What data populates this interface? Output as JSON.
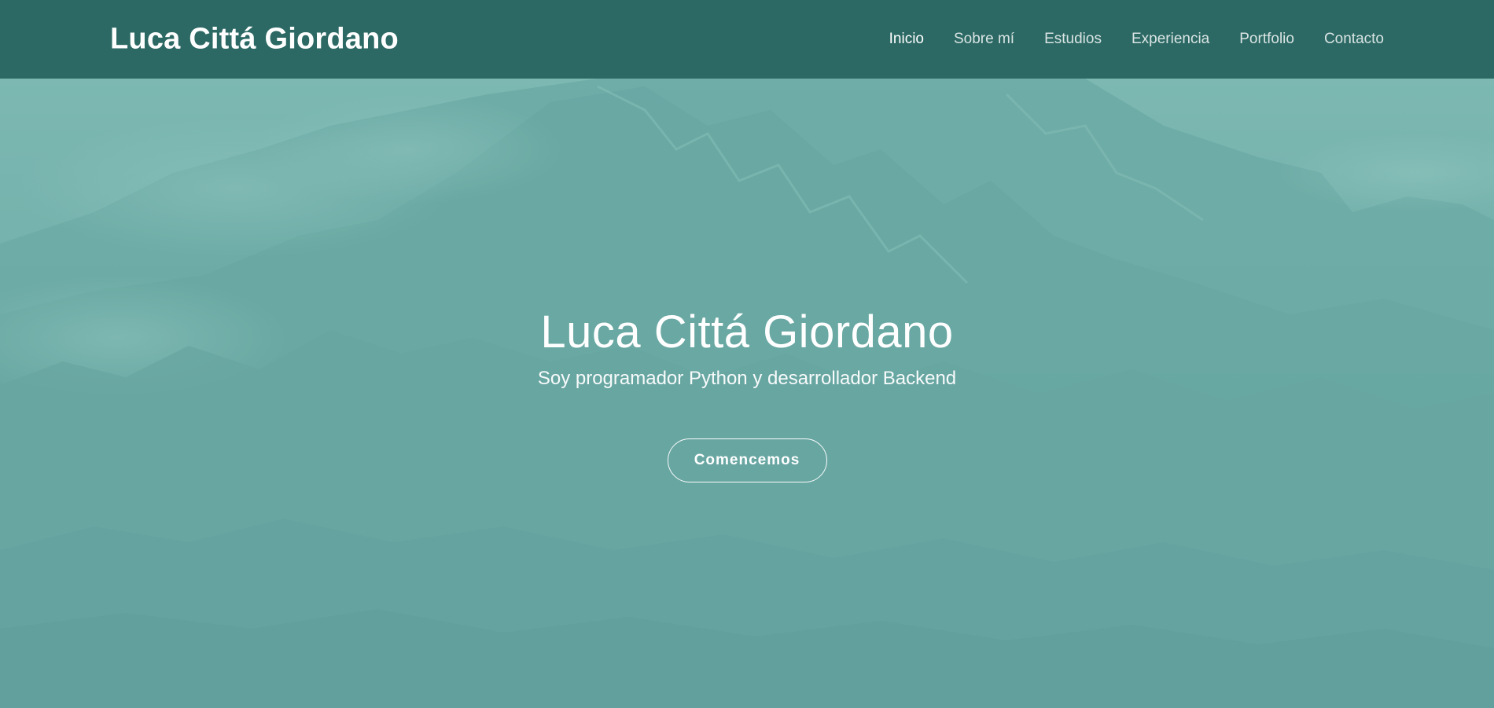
{
  "navbar": {
    "brand": "Luca Cittá Giordano",
    "links": [
      {
        "label": "Inicio",
        "active": true
      },
      {
        "label": "Sobre mí",
        "active": false
      },
      {
        "label": "Estudios",
        "active": false
      },
      {
        "label": "Experiencia",
        "active": false
      },
      {
        "label": "Portfolio",
        "active": false
      },
      {
        "label": "Contacto",
        "active": false
      }
    ]
  },
  "hero": {
    "title": "Luca Cittá Giordano",
    "subtitle": "Soy programador Python y desarrollador Backend",
    "cta_label": "Comencemos"
  },
  "colors": {
    "navbar_bg": "#2c6964",
    "hero_bg": "#6aa9a6",
    "text": "#ffffff"
  }
}
